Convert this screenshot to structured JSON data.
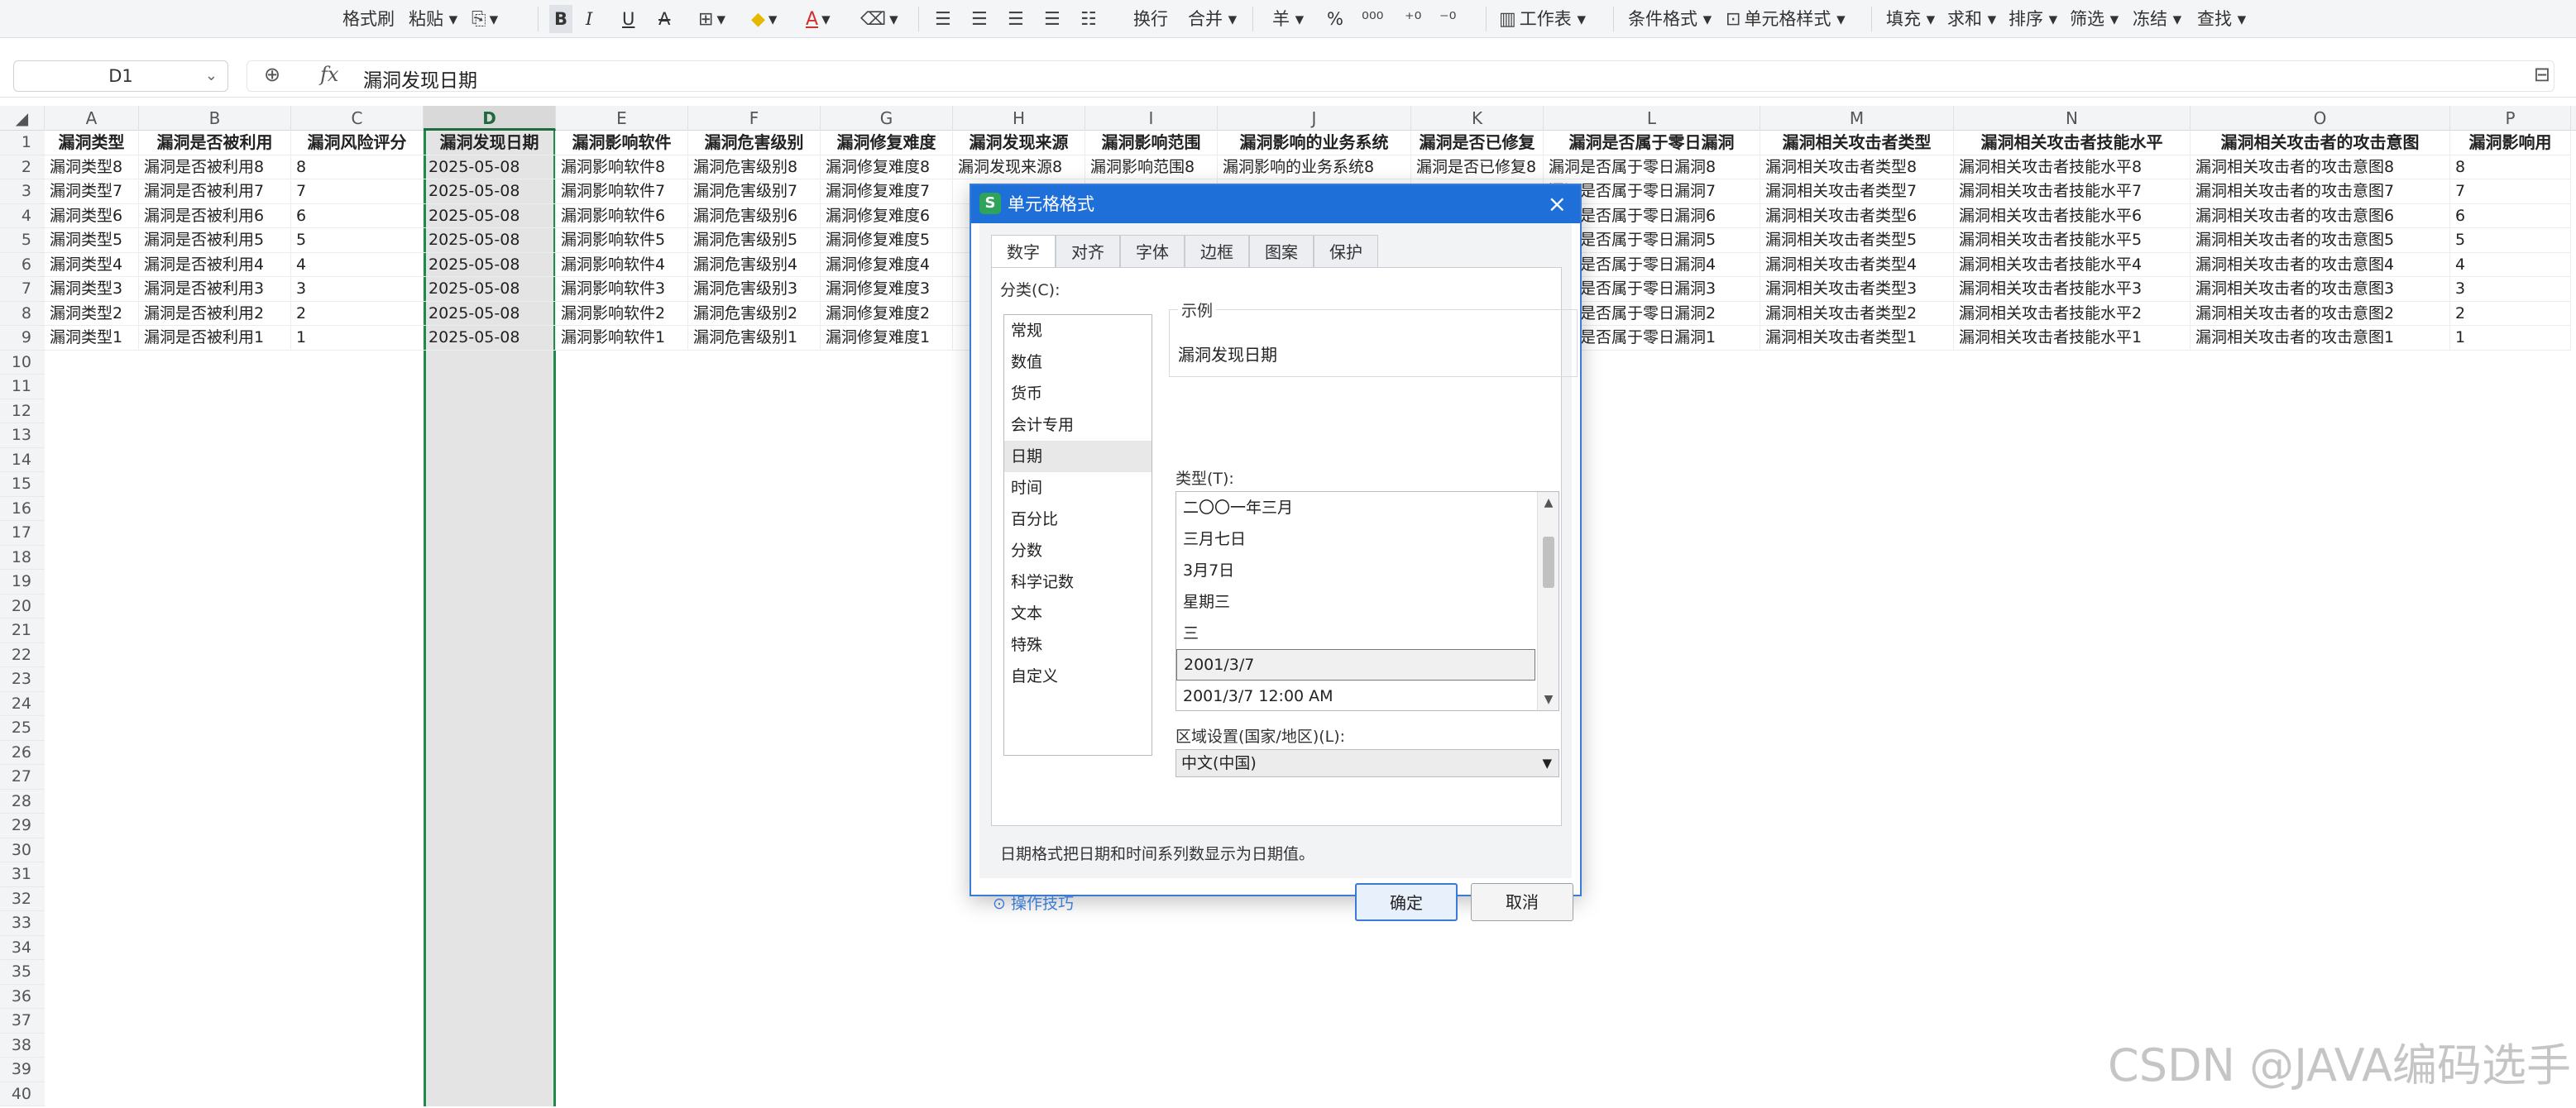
{
  "ribbon": {
    "items": [
      "格式刷",
      "粘贴",
      "B",
      "I",
      "U",
      "A",
      "换行",
      "合并",
      "羊",
      "%",
      "条件格式",
      "单元格样式",
      "填充",
      "求和",
      "排序",
      "筛选",
      "冻结",
      "查找"
    ],
    "worksheet_label": "工作表"
  },
  "formula_bar": {
    "cell_ref": "D1",
    "fx_label": "fx",
    "content": "漏洞发现日期"
  },
  "columns": [
    "A",
    "B",
    "C",
    "D",
    "E",
    "F",
    "G",
    "H",
    "I",
    "J",
    "K",
    "L",
    "M",
    "N",
    "O",
    "P"
  ],
  "selected_column": "D",
  "row_numbers": [
    "1",
    "2",
    "3",
    "4",
    "5",
    "6",
    "7",
    "8",
    "9",
    "10",
    "11",
    "12",
    "13",
    "14",
    "15",
    "16",
    "17",
    "18",
    "19",
    "20",
    "21",
    "22",
    "23",
    "24",
    "25",
    "26",
    "27",
    "28",
    "29",
    "30",
    "31",
    "32",
    "33",
    "34",
    "35",
    "36",
    "37",
    "38",
    "39",
    "40"
  ],
  "header_row": [
    "漏洞类型",
    "漏洞是否被利用",
    "漏洞风险评分",
    "漏洞发现日期",
    "漏洞影响软件",
    "漏洞危害级别",
    "漏洞修复难度",
    "漏洞发现来源",
    "漏洞影响范围",
    "漏洞影响的业务系统",
    "漏洞是否已修复",
    "漏洞是否属于零日漏洞",
    "漏洞相关攻击者类型",
    "漏洞相关攻击者技能水平",
    "漏洞相关攻击者的攻击意图",
    "漏洞影响用"
  ],
  "data_rows": [
    [
      "漏洞类型8",
      "漏洞是否被利用8",
      "8",
      "2025-05-08",
      "漏洞影响软件8",
      "漏洞危害级别8",
      "漏洞修复难度8",
      "漏洞发现来源8",
      "漏洞影响范围8",
      "漏洞影响的业务系统8",
      "漏洞是否已修复8",
      "漏洞是否属于零日漏洞8",
      "漏洞相关攻击者类型8",
      "漏洞相关攻击者技能水平8",
      "漏洞相关攻击者的攻击意图8",
      "8"
    ],
    [
      "漏洞类型7",
      "漏洞是否被利用7",
      "7",
      "2025-05-08",
      "漏洞影响软件7",
      "漏洞危害级别7",
      "漏洞修复难度7",
      "",
      "",
      "",
      "",
      "漏洞是否属于零日漏洞7",
      "漏洞相关攻击者类型7",
      "漏洞相关攻击者技能水平7",
      "漏洞相关攻击者的攻击意图7",
      "7"
    ],
    [
      "漏洞类型6",
      "漏洞是否被利用6",
      "6",
      "2025-05-08",
      "漏洞影响软件6",
      "漏洞危害级别6",
      "漏洞修复难度6",
      "",
      "",
      "",
      "",
      "漏洞是否属于零日漏洞6",
      "漏洞相关攻击者类型6",
      "漏洞相关攻击者技能水平6",
      "漏洞相关攻击者的攻击意图6",
      "6"
    ],
    [
      "漏洞类型5",
      "漏洞是否被利用5",
      "5",
      "2025-05-08",
      "漏洞影响软件5",
      "漏洞危害级别5",
      "漏洞修复难度5",
      "",
      "",
      "",
      "",
      "漏洞是否属于零日漏洞5",
      "漏洞相关攻击者类型5",
      "漏洞相关攻击者技能水平5",
      "漏洞相关攻击者的攻击意图5",
      "5"
    ],
    [
      "漏洞类型4",
      "漏洞是否被利用4",
      "4",
      "2025-05-08",
      "漏洞影响软件4",
      "漏洞危害级别4",
      "漏洞修复难度4",
      "",
      "",
      "",
      "",
      "漏洞是否属于零日漏洞4",
      "漏洞相关攻击者类型4",
      "漏洞相关攻击者技能水平4",
      "漏洞相关攻击者的攻击意图4",
      "4"
    ],
    [
      "漏洞类型3",
      "漏洞是否被利用3",
      "3",
      "2025-05-08",
      "漏洞影响软件3",
      "漏洞危害级别3",
      "漏洞修复难度3",
      "",
      "",
      "",
      "",
      "漏洞是否属于零日漏洞3",
      "漏洞相关攻击者类型3",
      "漏洞相关攻击者技能水平3",
      "漏洞相关攻击者的攻击意图3",
      "3"
    ],
    [
      "漏洞类型2",
      "漏洞是否被利用2",
      "2",
      "2025-05-08",
      "漏洞影响软件2",
      "漏洞危害级别2",
      "漏洞修复难度2",
      "",
      "",
      "",
      "",
      "漏洞是否属于零日漏洞2",
      "漏洞相关攻击者类型2",
      "漏洞相关攻击者技能水平2",
      "漏洞相关攻击者的攻击意图2",
      "2"
    ],
    [
      "漏洞类型1",
      "漏洞是否被利用1",
      "1",
      "2025-05-08",
      "漏洞影响软件1",
      "漏洞危害级别1",
      "漏洞修复难度1",
      "",
      "",
      "",
      "",
      "漏洞是否属于零日漏洞1",
      "漏洞相关攻击者类型1",
      "漏洞相关攻击者技能水平1",
      "漏洞相关攻击者的攻击意图1",
      "1"
    ]
  ],
  "dialog": {
    "title": "单元格格式",
    "tabs": [
      "数字",
      "对齐",
      "字体",
      "边框",
      "图案",
      "保护"
    ],
    "active_tab": "数字",
    "category_label": "分类(C):",
    "categories": [
      "常规",
      "数值",
      "货币",
      "会计专用",
      "日期",
      "时间",
      "百分比",
      "分数",
      "科学记数",
      "文本",
      "特殊",
      "自定义"
    ],
    "selected_category": "日期",
    "sample_label": "示例",
    "sample_value": "漏洞发现日期",
    "type_label": "类型(T):",
    "types": [
      "二〇〇一年三月",
      "三月七日",
      "3月7日",
      "星期三",
      "三",
      "2001/3/7",
      "2001/3/7 12:00 AM"
    ],
    "selected_type": "2001/3/7",
    "locale_label": "区域设置(国家/地区)(L):",
    "locale_value": "中文(中国)",
    "description": "日期格式把日期和时间系列数显示为日期值。",
    "tips_label": "操作技巧",
    "ok_label": "确定",
    "cancel_label": "取消"
  },
  "watermark": "CSDN @JAVA编码选手"
}
